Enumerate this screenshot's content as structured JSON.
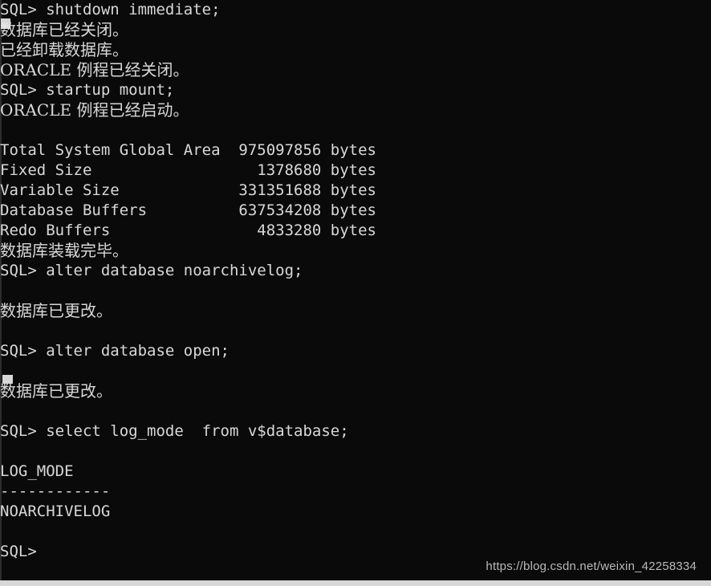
{
  "terminal": {
    "title": "SQL*Plus",
    "background_color": "#0a0a0a",
    "foreground_color": "#d8d8d8",
    "prompt": "SQL>",
    "lines": [
      {
        "text": "SQL> shutdown immediate;",
        "type": "command"
      },
      {
        "text": "数据库已经关闭。",
        "type": "output-cn"
      },
      {
        "text": "已经卸载数据库。",
        "type": "output-cn"
      },
      {
        "text": "ORACLE 例程已经关闭。",
        "type": "output-cn"
      },
      {
        "text": "SQL> startup mount;",
        "type": "command"
      },
      {
        "text": "ORACLE 例程已经启动。",
        "type": "output-cn"
      },
      {
        "text": "",
        "type": "blank"
      },
      {
        "text": "Total System Global Area  975097856 bytes",
        "type": "output"
      },
      {
        "text": "Fixed Size                  1378680 bytes",
        "type": "output"
      },
      {
        "text": "Variable Size             331351688 bytes",
        "type": "output"
      },
      {
        "text": "Database Buffers          637534208 bytes",
        "type": "output"
      },
      {
        "text": "Redo Buffers                4833280 bytes",
        "type": "output"
      },
      {
        "text": "数据库装载完毕。",
        "type": "output-cn"
      },
      {
        "text": "SQL> alter database noarchivelog;",
        "type": "command"
      },
      {
        "text": "",
        "type": "blank"
      },
      {
        "text": "数据库已更改。",
        "type": "output-cn"
      },
      {
        "text": "",
        "type": "blank"
      },
      {
        "text": "SQL> alter database open;",
        "type": "command"
      },
      {
        "text": "",
        "type": "blank"
      },
      {
        "text": "数据库已更改。",
        "type": "output-cn"
      },
      {
        "text": "",
        "type": "blank"
      },
      {
        "text": "SQL> select log_mode  from v$database;",
        "type": "command"
      },
      {
        "text": "",
        "type": "blank"
      },
      {
        "text": "LOG_MODE",
        "type": "output"
      },
      {
        "text": "------------",
        "type": "separator"
      },
      {
        "text": "NOARCHIVELOG",
        "type": "output"
      },
      {
        "text": "",
        "type": "blank"
      },
      {
        "text": "SQL>",
        "type": "prompt"
      }
    ]
  },
  "sga_report": {
    "title": "Total System Global Area",
    "total_bytes": "975097856",
    "unit": "bytes",
    "rows": [
      {
        "label": "Total System Global Area",
        "value": "975097856",
        "unit": "bytes"
      },
      {
        "label": "Fixed Size",
        "value": "1378680",
        "unit": "bytes"
      },
      {
        "label": "Variable Size",
        "value": "331351688",
        "unit": "bytes"
      },
      {
        "label": "Database Buffers",
        "value": "637534208",
        "unit": "bytes"
      },
      {
        "label": "Redo Buffers",
        "value": "4833280",
        "unit": "bytes"
      }
    ]
  },
  "query_result": {
    "column_header": "LOG_MODE",
    "separator": "------------",
    "value": "NOARCHIVELOG"
  },
  "commands_issued": [
    "shutdown immediate;",
    "startup mount;",
    "alter database noarchivelog;",
    "alter database open;",
    "select log_mode  from v$database;"
  ],
  "watermark": {
    "text": "https://blog.csdn.net/weixin_42258334"
  }
}
